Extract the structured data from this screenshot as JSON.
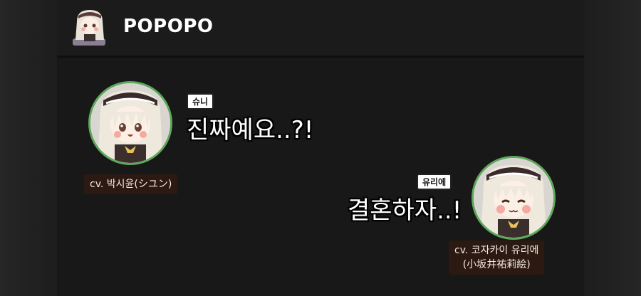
{
  "header": {
    "title": "POPOPO",
    "avatar_icon": "character-chibi-icon"
  },
  "messages": [
    {
      "speaker": "슈니",
      "text": "진짜예요..?!",
      "cv_label": "cv. 박시윤(シユン)"
    },
    {
      "speaker": "유리에",
      "text": "결혼하자..!",
      "cv_line1": "cv. 코자카이 유리에",
      "cv_line2": "(小坂井祐莉絵)"
    }
  ],
  "colors": {
    "avatar_border": "#5ea85c",
    "cv_background": "#2c1a12"
  }
}
